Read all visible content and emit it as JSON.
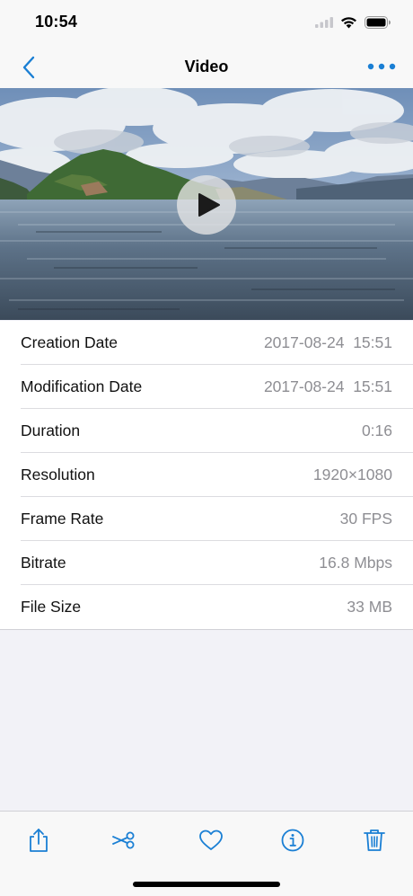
{
  "status_bar": {
    "time": "10:54"
  },
  "nav": {
    "title": "Video"
  },
  "video": {
    "play_icon": "play-icon"
  },
  "info": [
    {
      "label": "Creation Date",
      "value": "2017-08-24  15:51"
    },
    {
      "label": "Modification Date",
      "value": "2017-08-24  15:51"
    },
    {
      "label": "Duration",
      "value": "0:16"
    },
    {
      "label": "Resolution",
      "value": "1920×1080"
    },
    {
      "label": "Frame Rate",
      "value": "30 FPS"
    },
    {
      "label": "Bitrate",
      "value": "16.8 Mbps"
    },
    {
      "label": "File Size",
      "value": "33 MB"
    }
  ],
  "toolbar": {
    "icons": [
      "share-icon",
      "scissors-icon",
      "heart-icon",
      "info-icon",
      "trash-icon"
    ]
  },
  "colors": {
    "accent": "#1a7fd4",
    "secondary_text": "#8e8e93",
    "background": "#f2f2f7"
  }
}
